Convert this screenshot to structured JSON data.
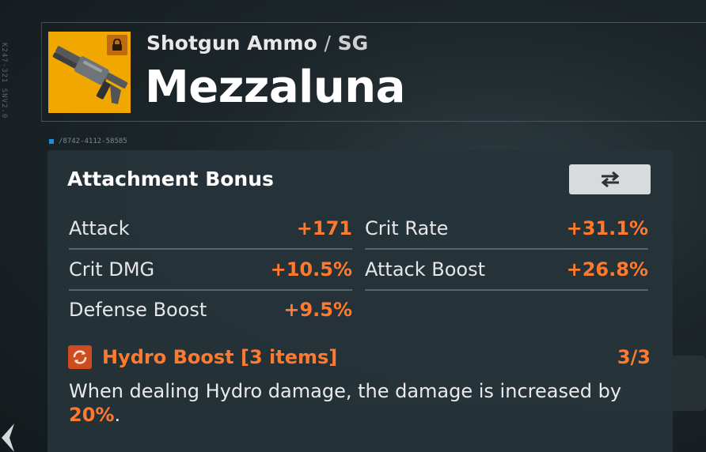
{
  "side_code": "K247-321 SNV2.0",
  "header": {
    "category": "Shotgun Ammo",
    "separator": "/",
    "category_short": "SG",
    "item_name": "Mezzaluna",
    "serial": "/8742-4112-58585"
  },
  "thumbnail": {
    "icon": "shotgun-icon",
    "lock_icon": "lock-icon"
  },
  "panel": {
    "title": "Attachment Bonus",
    "swap_icon": "swap-arrows-icon",
    "stats": [
      {
        "label": "Attack",
        "value": "+171"
      },
      {
        "label": "Crit Rate",
        "value": "+31.1%"
      },
      {
        "label": "Crit DMG",
        "value": "+10.5%"
      },
      {
        "label": "Attack Boost",
        "value": "+26.8%"
      },
      {
        "label": "Defense Boost",
        "value": "+9.5%"
      }
    ],
    "set_bonus": {
      "name": "Hydro Boost [3 items]",
      "count": "3/3",
      "description": "When dealing Hydro damage, the damage is increased by",
      "highlight": "20%",
      "suffix": "."
    }
  },
  "colors": {
    "accent": "#ff7a2e",
    "thumb_bg": "#f0a800",
    "panel_bg": "#26343a"
  }
}
